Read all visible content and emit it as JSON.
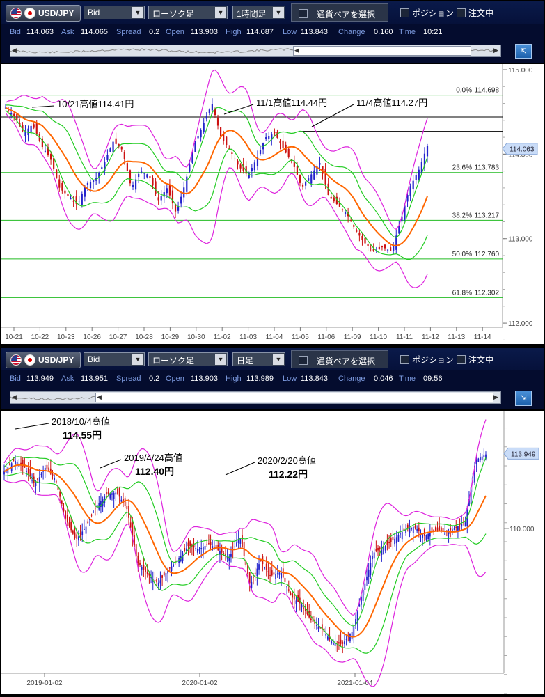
{
  "panels": [
    {
      "pair": "USD/JPY",
      "price_type": "Bid",
      "chart_type": "ローソク足",
      "timeframe": "1時間足",
      "pair_select_label": "通貨ペアを選択",
      "position_label": "ポジション",
      "order_label": "注文中",
      "info": {
        "bid_label": "Bid",
        "bid": "114.063",
        "ask_label": "Ask",
        "ask": "114.065",
        "spread_label": "Spread",
        "spread": "0.2",
        "open_label": "Open",
        "open": "113.903",
        "high_label": "High",
        "high": "114.087",
        "low_label": "Low",
        "low": "113.843",
        "change_label": "Change",
        "change": "0.160",
        "time_label": "Time",
        "time": "10:21"
      }
    },
    {
      "pair": "USD/JPY",
      "price_type": "Bid",
      "chart_type": "ローソク足",
      "timeframe": "日足",
      "pair_select_label": "通貨ペアを選択",
      "position_label": "ポジション",
      "order_label": "注文中",
      "info": {
        "bid_label": "Bid",
        "bid": "113.949",
        "ask_label": "Ask",
        "ask": "113.951",
        "spread_label": "Spread",
        "spread": "0.2",
        "open_label": "Open",
        "open": "113.903",
        "high_label": "High",
        "high": "113.989",
        "low_label": "Low",
        "low": "113.843",
        "change_label": "Change",
        "change": "0.046",
        "time_label": "Time",
        "time": "09:56"
      }
    }
  ],
  "colors": {
    "ma": "#ff6600",
    "bb_inner": "#22cc22",
    "bb_outer": "#dd22dd",
    "fib": "#22bb22",
    "resistance": "#000000",
    "candle_up": "#2222cc",
    "candle_down": "#cc1111",
    "price_label_bg": "#c9dcf8"
  },
  "chart_data": [
    {
      "type": "candlestick",
      "title": "",
      "timeframe": "1時間足",
      "ylim": [
        111.77,
        115.0
      ],
      "yticks": [
        {
          "value": 112.0,
          "label": "112.000"
        },
        {
          "value": 113.0,
          "label": "113.000"
        },
        {
          "value": 114.0,
          "label": "114.000"
        },
        {
          "value": 115.0,
          "label": "115.000"
        }
      ],
      "current_price": {
        "value": 114.063,
        "label": "114.063"
      },
      "x_ticks": [
        "10-21",
        "10-22",
        "10-23",
        "10-26",
        "10-27",
        "10-28",
        "10-29",
        "10-30",
        "11-02",
        "11-03",
        "11-04",
        "11-05",
        "11-06",
        "11-09",
        "11-10",
        "11-11",
        "11-12",
        "11-13",
        "11-14"
      ],
      "close_path": [
        114.55,
        114.45,
        114.25,
        114.35,
        114.1,
        113.95,
        113.6,
        113.5,
        113.4,
        113.65,
        113.7,
        113.9,
        114.15,
        114.05,
        113.6,
        113.8,
        113.75,
        113.45,
        113.6,
        113.3,
        113.65,
        114.1,
        114.35,
        114.6,
        114.2,
        114.05,
        113.85,
        113.75,
        113.95,
        114.2,
        114.25,
        114.05,
        113.9,
        113.6,
        113.75,
        113.9,
        113.5,
        113.4,
        113.3,
        113.1,
        112.95,
        112.85,
        112.9,
        112.85,
        113.2,
        113.6,
        113.8,
        114.1
      ],
      "fib_levels": [
        {
          "pct": "0.0%",
          "label": "114.698",
          "value": 114.698
        },
        {
          "pct": "23.6%",
          "label": "113.783",
          "value": 113.783
        },
        {
          "pct": "38.2%",
          "label": "113.217",
          "value": 113.217
        },
        {
          "pct": "50.0%",
          "label": "112.760",
          "value": 112.76
        },
        {
          "pct": "61.8%",
          "label": "112.302",
          "value": 112.302
        }
      ],
      "resistance_lines": [
        114.44,
        114.27
      ],
      "annotations": [
        {
          "text": "10/21高値114.41円",
          "target_x": "10-21",
          "value": 114.41
        },
        {
          "text": "11/1高値114.44円",
          "target_x": "11-02",
          "value": 114.44
        },
        {
          "text": "11/4高値114.27円",
          "target_x": "11-04",
          "value": 114.27
        }
      ]
    },
    {
      "type": "candlestick",
      "title": "",
      "timeframe": "日足",
      "ylim": [
        101.3,
        116.2
      ],
      "yticks": [
        {
          "value": 110.0,
          "label": "110.000"
        }
      ],
      "current_price": {
        "value": 113.949,
        "label": "113.949"
      },
      "x_ticks": [
        "2019-01-02",
        "2020-01-02",
        "2021-01-04"
      ],
      "close_path": [
        113.0,
        113.6,
        113.2,
        112.3,
        113.2,
        112.6,
        110.5,
        109.4,
        110.1,
        111.2,
        111.8,
        111.9,
        111.0,
        108.2,
        107.6,
        107.1,
        107.8,
        108.4,
        109.1,
        108.9,
        109.2,
        108.8,
        108.5,
        109.6,
        107.0,
        108.3,
        107.5,
        107.7,
        106.4,
        106.0,
        105.1,
        104.7,
        104.0,
        103.9,
        104.6,
        106.7,
        108.7,
        109.0,
        109.4,
        109.9,
        110.1,
        109.6,
        109.9,
        109.8,
        110.0,
        110.4,
        113.6,
        113.9
      ],
      "annotations": [
        {
          "text": "2018/10/4高値",
          "value_text": "114.55円",
          "value": 114.55
        },
        {
          "text": "2019/4/24高値",
          "value_text": "112.40円",
          "value": 112.4
        },
        {
          "text": "2020/2/20高値",
          "value_text": "112.22円",
          "value": 112.22
        }
      ]
    }
  ]
}
